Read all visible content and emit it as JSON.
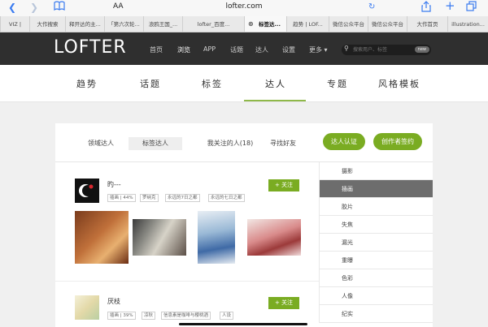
{
  "browser": {
    "text_size_label": "AA",
    "url": "lofter.com",
    "tabs": [
      "VIZ |",
      "大作搜索",
      "释开达的主...",
      "「第六次轮...",
      "浪鸥王国_...",
      "lofter_百度...",
      "标签达...",
      "趋势 | LOF...",
      "微信公众平台",
      "微信公众平台",
      "大作首页",
      "illustration..."
    ]
  },
  "lofter": {
    "logo": "LOFTER",
    "nav": [
      "首页",
      "浏览",
      "APP",
      "话题",
      "达人",
      "设置",
      "更多 ▾"
    ],
    "search_placeholder": "搜索用户、标签",
    "search_badge": "new"
  },
  "subnav": [
    "趋势",
    "话题",
    "标签",
    "达人",
    "专题",
    "风格模板"
  ],
  "card": {
    "tabs": [
      "领域达人",
      "标签达人",
      "我关注的人(18)",
      "寻找好友"
    ],
    "buttons": [
      "达人认证",
      "创作者签约"
    ],
    "categories": [
      "摄影",
      "插画",
      "胶片",
      "失焦",
      "漏光",
      "重曝",
      "色彩",
      "人像",
      "纪实"
    ],
    "users": [
      {
        "name": "旳---",
        "tags": [
          "插画 | 44%",
          "罗纳克",
          "永远的7日之都",
          "永远的七日之都"
        ],
        "follow": "+ 关注"
      },
      {
        "name": "厌枝",
        "tags": [
          "插画 | 39%",
          "凉秋",
          "信息素是咖啡与樱桃酒",
          "人设"
        ],
        "follow": "+ 关注"
      }
    ]
  },
  "colors": {
    "accent": "#7aac22",
    "nav_bg": "#2f2f2f",
    "active_cat": "#6d6d6d"
  }
}
